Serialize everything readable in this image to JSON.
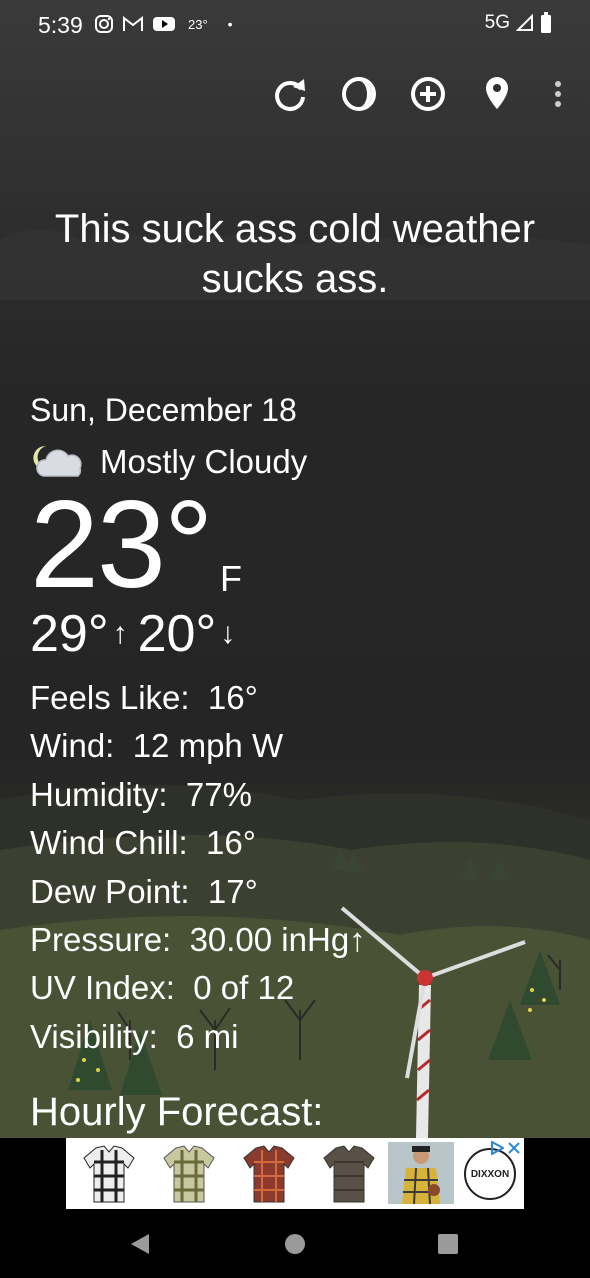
{
  "status_bar": {
    "time": "5:39",
    "temp": "23°",
    "network": "5G",
    "icons": [
      "instagram-icon",
      "gmail-icon",
      "youtube-icon",
      "signal-icon",
      "battery-icon"
    ]
  },
  "toolbar": {
    "buttons": [
      "refresh-icon",
      "theme-icon",
      "add-location-icon",
      "location-pin-icon",
      "more-vert-icon"
    ]
  },
  "headline": "This suck ass cold weather sucks ass.",
  "current": {
    "date": "Sun, December 18",
    "condition": "Mostly Cloudy",
    "condition_icon": "partly-cloudy-night-icon",
    "temp": "23°",
    "unit": "F",
    "high": "29°",
    "low": "20°"
  },
  "details": [
    {
      "label": "Feels Like:",
      "value": "16°"
    },
    {
      "label": "Wind:",
      "value": "12 mph W"
    },
    {
      "label": "Humidity:",
      "value": "77%"
    },
    {
      "label": "Wind Chill:",
      "value": "16°"
    },
    {
      "label": "Dew Point:",
      "value": "17°"
    },
    {
      "label": "Pressure:",
      "value": "30.00 inHg↑"
    },
    {
      "label": "UV Index:",
      "value": "0 of 12"
    },
    {
      "label": "Visibility:",
      "value": "6 mi"
    }
  ],
  "hourly_title": "Hourly Forecast:",
  "ad": {
    "brand_text": "DIXXON",
    "items": [
      "plaid-shirt-white-black",
      "plaid-shirt-green",
      "plaid-shirt-red",
      "plaid-shirt-brown",
      "model-in-plaid-shirt"
    ]
  },
  "colors": {
    "text": "#ffffff",
    "sky_dark": "#262626",
    "ground": "#4a5236"
  }
}
